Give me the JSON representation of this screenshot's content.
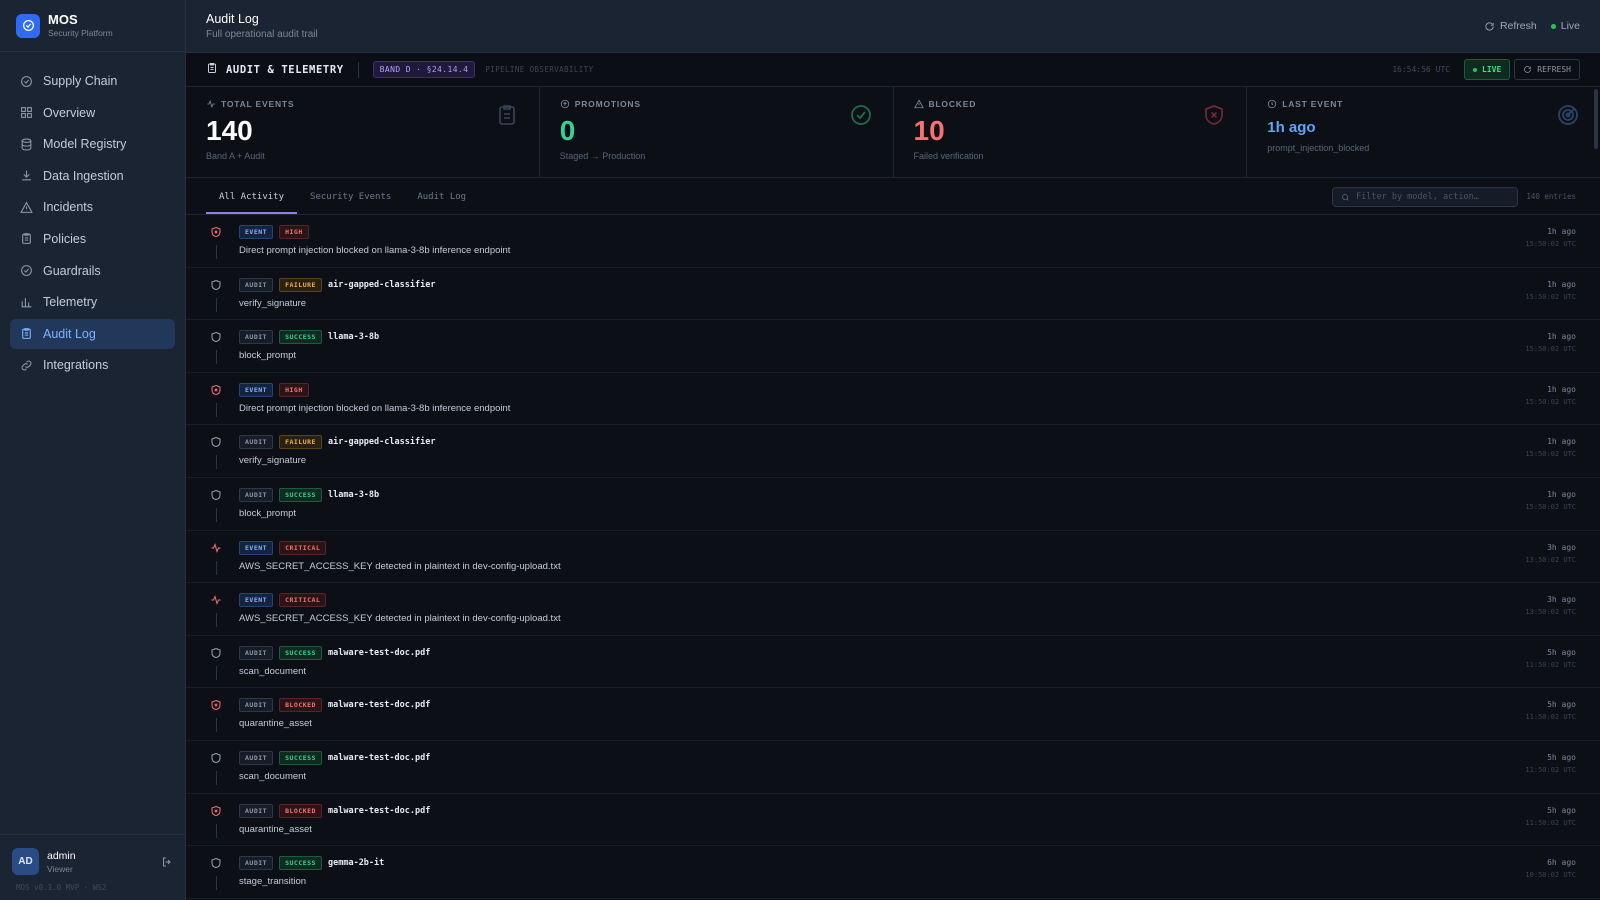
{
  "brand": {
    "name": "MOS",
    "subtitle": "Security Platform"
  },
  "sidebar": {
    "items": [
      {
        "label": "Supply Chain",
        "icon": "shield-check-icon"
      },
      {
        "label": "Overview",
        "icon": "grid-icon"
      },
      {
        "label": "Model Registry",
        "icon": "database-icon"
      },
      {
        "label": "Data Ingestion",
        "icon": "download-icon"
      },
      {
        "label": "Incidents",
        "icon": "warning-icon"
      },
      {
        "label": "Policies",
        "icon": "clipboard-icon"
      },
      {
        "label": "Guardrails",
        "icon": "check-circle-icon"
      },
      {
        "label": "Telemetry",
        "icon": "bar-chart-icon"
      },
      {
        "label": "Audit Log",
        "icon": "scroll-icon",
        "active": true
      },
      {
        "label": "Integrations",
        "icon": "link-icon"
      }
    ],
    "user": {
      "initials": "AD",
      "name": "admin",
      "role": "Viewer"
    },
    "version": "MOS v0.1.0 MVP · WS2"
  },
  "header": {
    "title": "Audit Log",
    "subtitle": "Full operational audit trail",
    "refresh_label": "Refresh",
    "live_label": "Live"
  },
  "subbar": {
    "title": "AUDIT & TELEMETRY",
    "band": "BAND D · §24.14.4",
    "pipeline": "PIPELINE OBSERVABILITY",
    "clock": "16:54:56 UTC",
    "live_button": "LIVE",
    "refresh_button": "REFRESH"
  },
  "stats": [
    {
      "label": "TOTAL EVENTS",
      "value": "140",
      "sub": "Band A + Audit",
      "color": "#ffffff"
    },
    {
      "label": "PROMOTIONS",
      "value": "0",
      "sub": "Staged → Production",
      "color": "#34d399"
    },
    {
      "label": "BLOCKED",
      "value": "10",
      "sub": "Failed verification",
      "color": "#f87171"
    },
    {
      "label": "LAST EVENT",
      "value": "1h ago",
      "sub": "prompt_injection_blocked",
      "color": "#60a5fa"
    }
  ],
  "tabs": [
    {
      "label": "All Activity",
      "active": true
    },
    {
      "label": "Security Events"
    },
    {
      "label": "Audit Log"
    }
  ],
  "filter": {
    "placeholder": "Filter by model, action…",
    "entries": "140 entries"
  },
  "rows": [
    {
      "icon": "shield-x",
      "type": "EVENT",
      "status": "HIGH",
      "asset": "",
      "desc": "Direct prompt injection blocked on llama-3-8b inference endpoint",
      "rel": "1h ago",
      "abs": "15:50:02 UTC"
    },
    {
      "icon": "shield",
      "type": "AUDIT",
      "status": "FAILURE",
      "asset": "air-gapped-classifier",
      "desc": "verify_signature",
      "rel": "1h ago",
      "abs": "15:50:02 UTC"
    },
    {
      "icon": "shield",
      "type": "AUDIT",
      "status": "SUCCESS",
      "asset": "llama-3-8b",
      "desc": "block_prompt",
      "rel": "1h ago",
      "abs": "15:50:02 UTC"
    },
    {
      "icon": "shield-x",
      "type": "EVENT",
      "status": "HIGH",
      "asset": "",
      "desc": "Direct prompt injection blocked on llama-3-8b inference endpoint",
      "rel": "1h ago",
      "abs": "15:50:02 UTC"
    },
    {
      "icon": "shield",
      "type": "AUDIT",
      "status": "FAILURE",
      "asset": "air-gapped-classifier",
      "desc": "verify_signature",
      "rel": "1h ago",
      "abs": "15:50:02 UTC"
    },
    {
      "icon": "shield",
      "type": "AUDIT",
      "status": "SUCCESS",
      "asset": "llama-3-8b",
      "desc": "block_prompt",
      "rel": "1h ago",
      "abs": "15:50:02 UTC"
    },
    {
      "icon": "pulse",
      "type": "EVENT",
      "status": "CRITICAL",
      "asset": "",
      "desc": "AWS_SECRET_ACCESS_KEY detected in plaintext in dev-config-upload.txt",
      "rel": "3h ago",
      "abs": "13:50:02 UTC"
    },
    {
      "icon": "pulse",
      "type": "EVENT",
      "status": "CRITICAL",
      "asset": "",
      "desc": "AWS_SECRET_ACCESS_KEY detected in plaintext in dev-config-upload.txt",
      "rel": "3h ago",
      "abs": "13:50:02 UTC"
    },
    {
      "icon": "shield",
      "type": "AUDIT",
      "status": "SUCCESS",
      "asset": "malware-test-doc.pdf",
      "desc": "scan_document",
      "rel": "5h ago",
      "abs": "11:50:02 UTC"
    },
    {
      "icon": "shield-x",
      "type": "AUDIT",
      "status": "BLOCKED",
      "asset": "malware-test-doc.pdf",
      "desc": "quarantine_asset",
      "rel": "5h ago",
      "abs": "11:50:02 UTC"
    },
    {
      "icon": "shield",
      "type": "AUDIT",
      "status": "SUCCESS",
      "asset": "malware-test-doc.pdf",
      "desc": "scan_document",
      "rel": "5h ago",
      "abs": "11:50:02 UTC"
    },
    {
      "icon": "shield-x",
      "type": "AUDIT",
      "status": "BLOCKED",
      "asset": "malware-test-doc.pdf",
      "desc": "quarantine_asset",
      "rel": "5h ago",
      "abs": "11:50:02 UTC"
    },
    {
      "icon": "shield",
      "type": "AUDIT",
      "status": "SUCCESS",
      "asset": "gemma-2b-it",
      "desc": "stage_transition",
      "rel": "6h ago",
      "abs": "10:50:02 UTC"
    }
  ]
}
